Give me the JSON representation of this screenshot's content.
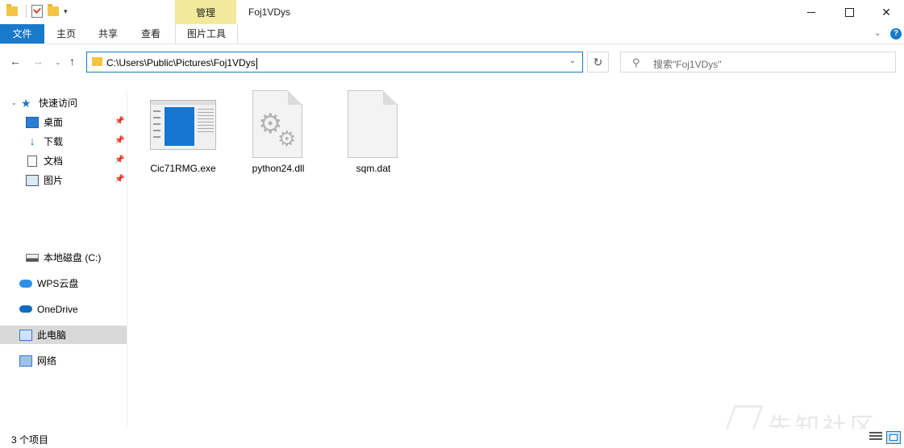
{
  "titlebar": {
    "title": "Foj1VDys",
    "contextual_tab": "管理"
  },
  "ribbon": {
    "tabs": [
      "文件",
      "主页",
      "共享",
      "查看",
      "图片工具"
    ],
    "accent": "#1979ca",
    "contextual_color": "#f2ea9a"
  },
  "address": {
    "path": "C:\\Users\\Public\\Pictures\\Foj1VDys"
  },
  "search": {
    "placeholder": "搜索\"Foj1VDys\""
  },
  "sidebar": {
    "items": [
      {
        "label": "快速访问",
        "icon": "star-icon"
      },
      {
        "label": "桌面",
        "icon": "desktop-icon",
        "pinned": true
      },
      {
        "label": "下载",
        "icon": "download-icon",
        "pinned": true
      },
      {
        "label": "文档",
        "icon": "document-icon",
        "pinned": true
      },
      {
        "label": "图片",
        "icon": "pictures-icon",
        "pinned": true
      },
      {
        "label": "本地磁盘 (C:)",
        "icon": "drive-icon"
      },
      {
        "label": "WPS云盘",
        "icon": "cloud-icon"
      },
      {
        "label": "OneDrive",
        "icon": "onedrive-icon"
      },
      {
        "label": "此电脑",
        "icon": "this-pc-icon",
        "selected": true
      },
      {
        "label": "网络",
        "icon": "network-icon"
      }
    ]
  },
  "files": [
    {
      "name": "Cic71RMG.exe",
      "icon": "exe-icon"
    },
    {
      "name": "python24.dll",
      "icon": "dll-icon"
    },
    {
      "name": "sqm.dat",
      "icon": "file-icon"
    }
  ],
  "status": {
    "count_text": "3 个项目"
  },
  "watermark": {
    "text": "先知社区"
  }
}
